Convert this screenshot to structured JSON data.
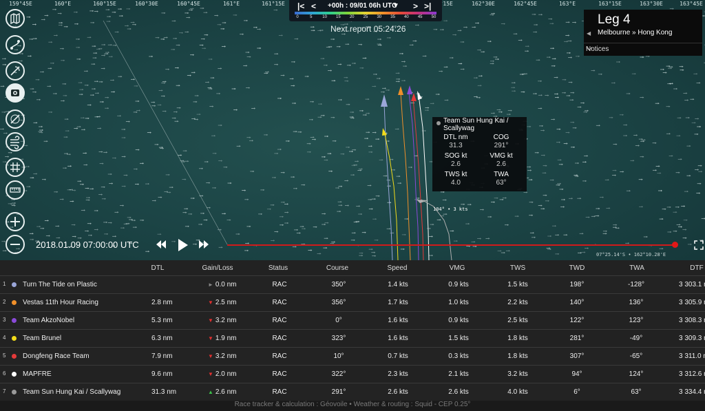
{
  "map": {
    "lon_labels": [
      "159°45E",
      "160°E",
      "160°15E",
      "160°30E",
      "160°45E",
      "161°E",
      "161°15E",
      "161°30E",
      "161°45E",
      "162°E",
      "162°15E",
      "162°30E",
      "162°45E",
      "163°E",
      "163°15E",
      "163°30E",
      "163°45E"
    ],
    "time_control": {
      "label": "+00h : 09/01 06h UTC",
      "scale_labels": [
        "0",
        "5",
        "10",
        "15",
        "20",
        "25",
        "30",
        "35",
        "40",
        "45",
        "50"
      ]
    },
    "next_report": "Next report 05:24:26",
    "leg": {
      "title": "Leg 4",
      "route": "Melbourne » Hong Kong",
      "notices": "Notices"
    },
    "playback": {
      "datetime": "2018.01.09 07:00:00 UTC"
    },
    "position_readout": "07°25.14'S • 162°10.28'E",
    "vessel_label": "104° • 3 kts",
    "info_box": {
      "team": "Team Sun Hung Kai / Scallywag",
      "fields": [
        {
          "label": "DTL nm",
          "value": "31.3"
        },
        {
          "label": "COG",
          "value": "291°"
        },
        {
          "label": "SOG kt",
          "value": "2.6"
        },
        {
          "label": "VMG kt",
          "value": "2.6"
        },
        {
          "label": "TWS kt",
          "value": "4.0"
        },
        {
          "label": "TWA",
          "value": "63°"
        }
      ]
    },
    "sidebar_icons": [
      "map-icon",
      "route-icon",
      "compass-icon",
      "camera-icon",
      "navigation-icon",
      "wind-icon",
      "grid-icon",
      "ruler-icon",
      "zoom-in-icon",
      "zoom-out-icon"
    ]
  },
  "table": {
    "headers": [
      "DTL",
      "Gain/Loss",
      "Status",
      "Course",
      "Speed",
      "VMG",
      "TWS",
      "TWD",
      "TWA",
      "DTF"
    ],
    "rows": [
      {
        "rank": "1",
        "color": "#9aa6d8",
        "name": "Turn The Tide on Plastic",
        "dtl": "",
        "gl_dir": "same",
        "gl": "0.0 nm",
        "status": "RAC",
        "course": "350°",
        "speed": "1.4 kts",
        "vmg": "0.9 kts",
        "tws": "1.5 kts",
        "twd": "198°",
        "twa": "-128°",
        "dtf": "3 303.1 n"
      },
      {
        "rank": "2",
        "color": "#f0902a",
        "name": "Vestas 11th Hour Racing",
        "dtl": "2.8 nm",
        "gl_dir": "down",
        "gl": "2.5 nm",
        "status": "RAC",
        "course": "356°",
        "speed": "1.7 kts",
        "vmg": "1.0 kts",
        "tws": "2.2 kts",
        "twd": "140°",
        "twa": "136°",
        "dtf": "3 305.9 n"
      },
      {
        "rank": "3",
        "color": "#8a4ad8",
        "name": "Team AkzoNobel",
        "dtl": "5.3 nm",
        "gl_dir": "down",
        "gl": "3.2 nm",
        "status": "RAC",
        "course": "0°",
        "speed": "1.6 kts",
        "vmg": "0.9 kts",
        "tws": "2.5 kts",
        "twd": "122°",
        "twa": "123°",
        "dtf": "3 308.3 n"
      },
      {
        "rank": "4",
        "color": "#f2dc1a",
        "name": "Team Brunel",
        "dtl": "6.3 nm",
        "gl_dir": "down",
        "gl": "1.9 nm",
        "status": "RAC",
        "course": "323°",
        "speed": "1.6 kts",
        "vmg": "1.5 kts",
        "tws": "1.8 kts",
        "twd": "281°",
        "twa": "-49°",
        "dtf": "3 309.3 n"
      },
      {
        "rank": "5",
        "color": "#e43a3a",
        "name": "Dongfeng Race Team",
        "dtl": "7.9 nm",
        "gl_dir": "down",
        "gl": "3.2 nm",
        "status": "RAC",
        "course": "10°",
        "speed": "0.7 kts",
        "vmg": "0.3 kts",
        "tws": "1.8 kts",
        "twd": "307°",
        "twa": "-65°",
        "dtf": "3 311.0 n"
      },
      {
        "rank": "6",
        "color": "#ffffff",
        "name": "MAPFRE",
        "dtl": "9.6 nm",
        "gl_dir": "down",
        "gl": "2.0 nm",
        "status": "RAC",
        "course": "322°",
        "speed": "2.3 kts",
        "vmg": "2.1 kts",
        "tws": "3.2 kts",
        "twd": "94°",
        "twa": "124°",
        "dtf": "3 312.6 n"
      },
      {
        "rank": "7",
        "color": "#9a9a9a",
        "name": "Team Sun Hung Kai / Scallywag",
        "dtl": "31.3 nm",
        "gl_dir": "up",
        "gl": "2.6 nm",
        "status": "RAC",
        "course": "291°",
        "speed": "2.6 kts",
        "vmg": "2.6 kts",
        "tws": "4.0 kts",
        "twd": "6°",
        "twa": "63°",
        "dtf": "3 334.4 n"
      }
    ]
  },
  "footer": "Race tracker & calculation : Géovoile • Weather & routing : Squid - CEP 0.25°"
}
